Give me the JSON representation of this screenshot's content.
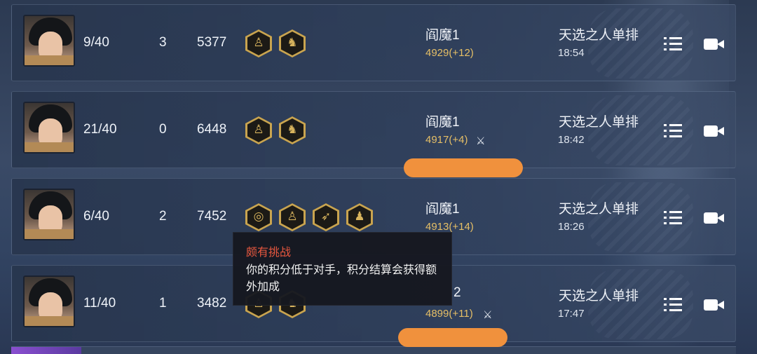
{
  "matches": [
    {
      "rank": "9/40",
      "kills": "3",
      "score": "5377",
      "badges": [
        "seated-figure-icon",
        "warrior-icon"
      ],
      "opponent": "阎魔1",
      "opponent_score": "4929(+12)",
      "challenge": false,
      "mode": "天选之人单排",
      "time": "18:54"
    },
    {
      "rank": "21/40",
      "kills": "0",
      "score": "6448",
      "badges": [
        "seated-figure-icon",
        "warrior-icon"
      ],
      "opponent": "阎魔1",
      "opponent_score": "4917(+4)",
      "challenge": true,
      "mode": "天选之人单排",
      "time": "18:42"
    },
    {
      "rank": "6/40",
      "kills": "2",
      "score": "7452",
      "badges": [
        "bow-spiral-icon",
        "seated-figure-icon",
        "bow-icon",
        "boot-icon"
      ],
      "opponent": "阎魔1",
      "opponent_score": "4913(+14)",
      "challenge": false,
      "mode": "天选之人单排",
      "time": "18:26"
    },
    {
      "rank": "11/40",
      "kills": "1",
      "score": "3482",
      "badges": [
        "seated-figure-icon",
        "warrior-icon"
      ],
      "opponent": "2",
      "opponent_score": "4899(+11)",
      "challenge": true,
      "mode": "天选之人单排",
      "time": "17:47"
    }
  ],
  "tooltip": {
    "title": "颇有挑战",
    "body": "你的积分低于对手，积分结算会获得额外加成"
  },
  "colors": {
    "opponent_score": "#e6bf66",
    "tooltip_title": "#e7573f",
    "badge_gold": "#c9a44f",
    "redaction": "#f0913d"
  }
}
